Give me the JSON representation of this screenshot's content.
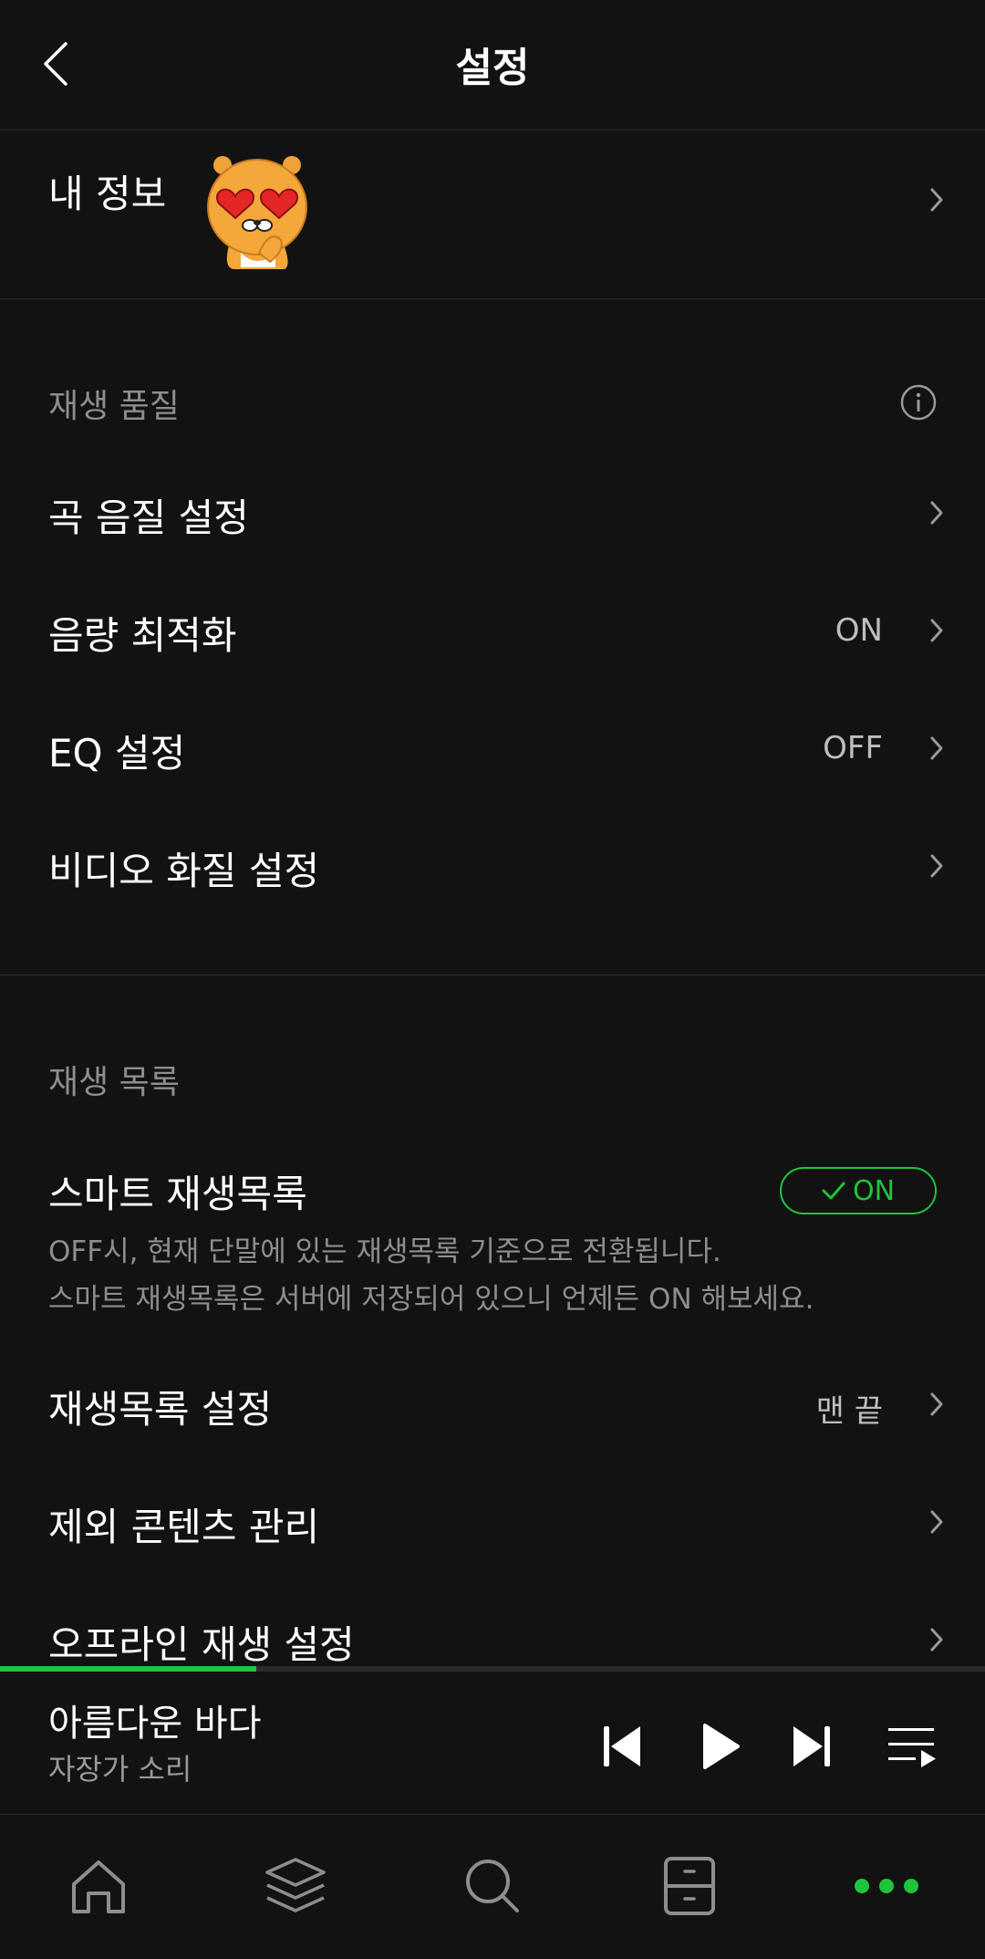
{
  "header": {
    "title": "설정"
  },
  "profile": {
    "label": "내 정보"
  },
  "playback_quality": {
    "section_title": "재생 품질",
    "items": [
      {
        "label": "곡 음질 설정",
        "value": ""
      },
      {
        "label": "음량 최적화",
        "value": "ON"
      },
      {
        "label": "EQ 설정",
        "value": "OFF"
      },
      {
        "label": "비디오 화질 설정",
        "value": ""
      }
    ]
  },
  "playlist": {
    "section_title": "재생 목록",
    "smart_playlist": {
      "label": "스마트 재생목록",
      "toggle": "ON",
      "desc_line1": "OFF시, 현재 단말에 있는 재생목록 기준으로 전환됩니다.",
      "desc_line2": "스마트 재생목록은 서버에 저장되어 있으니 언제든 ON 해보세요."
    },
    "items": [
      {
        "label": "재생목록 설정",
        "value": "맨 끝"
      },
      {
        "label": "제외 콘텐츠 관리",
        "value": ""
      },
      {
        "label": "오프라인 재생 설정",
        "value": ""
      }
    ]
  },
  "player": {
    "title": "아름다운 바다",
    "artist": "자장가 소리",
    "progress": 0.26
  },
  "colors": {
    "accent": "#1ec43c",
    "background": "#121212",
    "muted": "#8e8e8e"
  },
  "bottom_nav": {
    "items": [
      "home-icon",
      "layers-icon",
      "search-icon",
      "storage-icon",
      "more-icon"
    ]
  }
}
